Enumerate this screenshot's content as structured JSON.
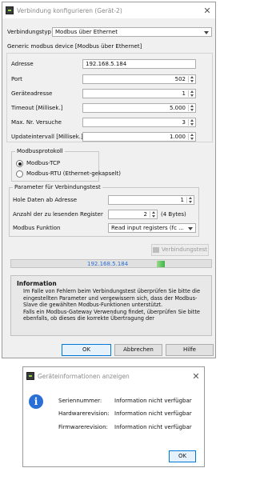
{
  "dialog1": {
    "title": "Verbindung konfigurieren (Gerät-2)",
    "connection_type_label": "Verbindungstyp",
    "connection_type_value": "Modbus über Ethernet",
    "section_header": "Generic modbus device [Modbus über Ethernet]",
    "fields": {
      "address": {
        "label": "Adresse",
        "value": "192.168.5.184"
      },
      "port": {
        "label": "Port",
        "value": "502"
      },
      "device_address": {
        "label": "Geräteadresse",
        "value": "1"
      },
      "timeout": {
        "label": "Timeout [Millisek.]",
        "value": "5.000"
      },
      "max_attempts": {
        "label": "Max. Nr. Versuche",
        "value": "3"
      },
      "update_interval": {
        "label": "Updateintervall [Millisek.]",
        "value": "1.000"
      }
    },
    "modbus_protocol": {
      "title": "Modbusprotokoll",
      "option_tcp": "Modbus-TCP",
      "option_rtu": "Modbus-RTU (Ethernet-gekapselt)",
      "selected": "tcp"
    },
    "test_params": {
      "title": "Parameter für Verbindungstest",
      "start_address_label": "Hole Daten ab Adresse",
      "start_address_value": "1",
      "register_count_label": "Anzahl der zu lesenden Register",
      "register_count_value": "2",
      "register_count_unit": "(4 Bytes)",
      "function_label": "Modbus Funktion",
      "function_value": "Read input registers (fc ..."
    },
    "test_button": "Verbindungstest",
    "status_ip": "192.168.5.184",
    "info": {
      "title": "Information",
      "text": "Im Falle von Fehlern beim Verbindungstest überprüfen Sie bitte die eingestellten Parameter und vergewissern sich, dass der Modbus-Slave die gewählten Modbus-Funktionen unterstützt.\nFalls ein Modbus-Gateway Verwendung findet, überprüfen Sie bitte ebenfalls, ob dieses die korrekte Übertragung der"
    },
    "buttons": {
      "ok": "OK",
      "cancel": "Abbrechen",
      "help": "Hilfe"
    }
  },
  "dialog2": {
    "title": "Geräteinformationen anzeigen",
    "rows": [
      {
        "label": "Seriennummer:",
        "value": "Information nicht verfügbar"
      },
      {
        "label": "Hardwarerevision:",
        "value": "Information nicht verfügbar"
      },
      {
        "label": "Firmwarerevision:",
        "value": "Information nicht verfügbar"
      }
    ],
    "ok": "OK"
  },
  "colors": {
    "accent": "#0078d7",
    "progress_green": "#3bb54a",
    "info_blue": "#2a6fd6"
  }
}
